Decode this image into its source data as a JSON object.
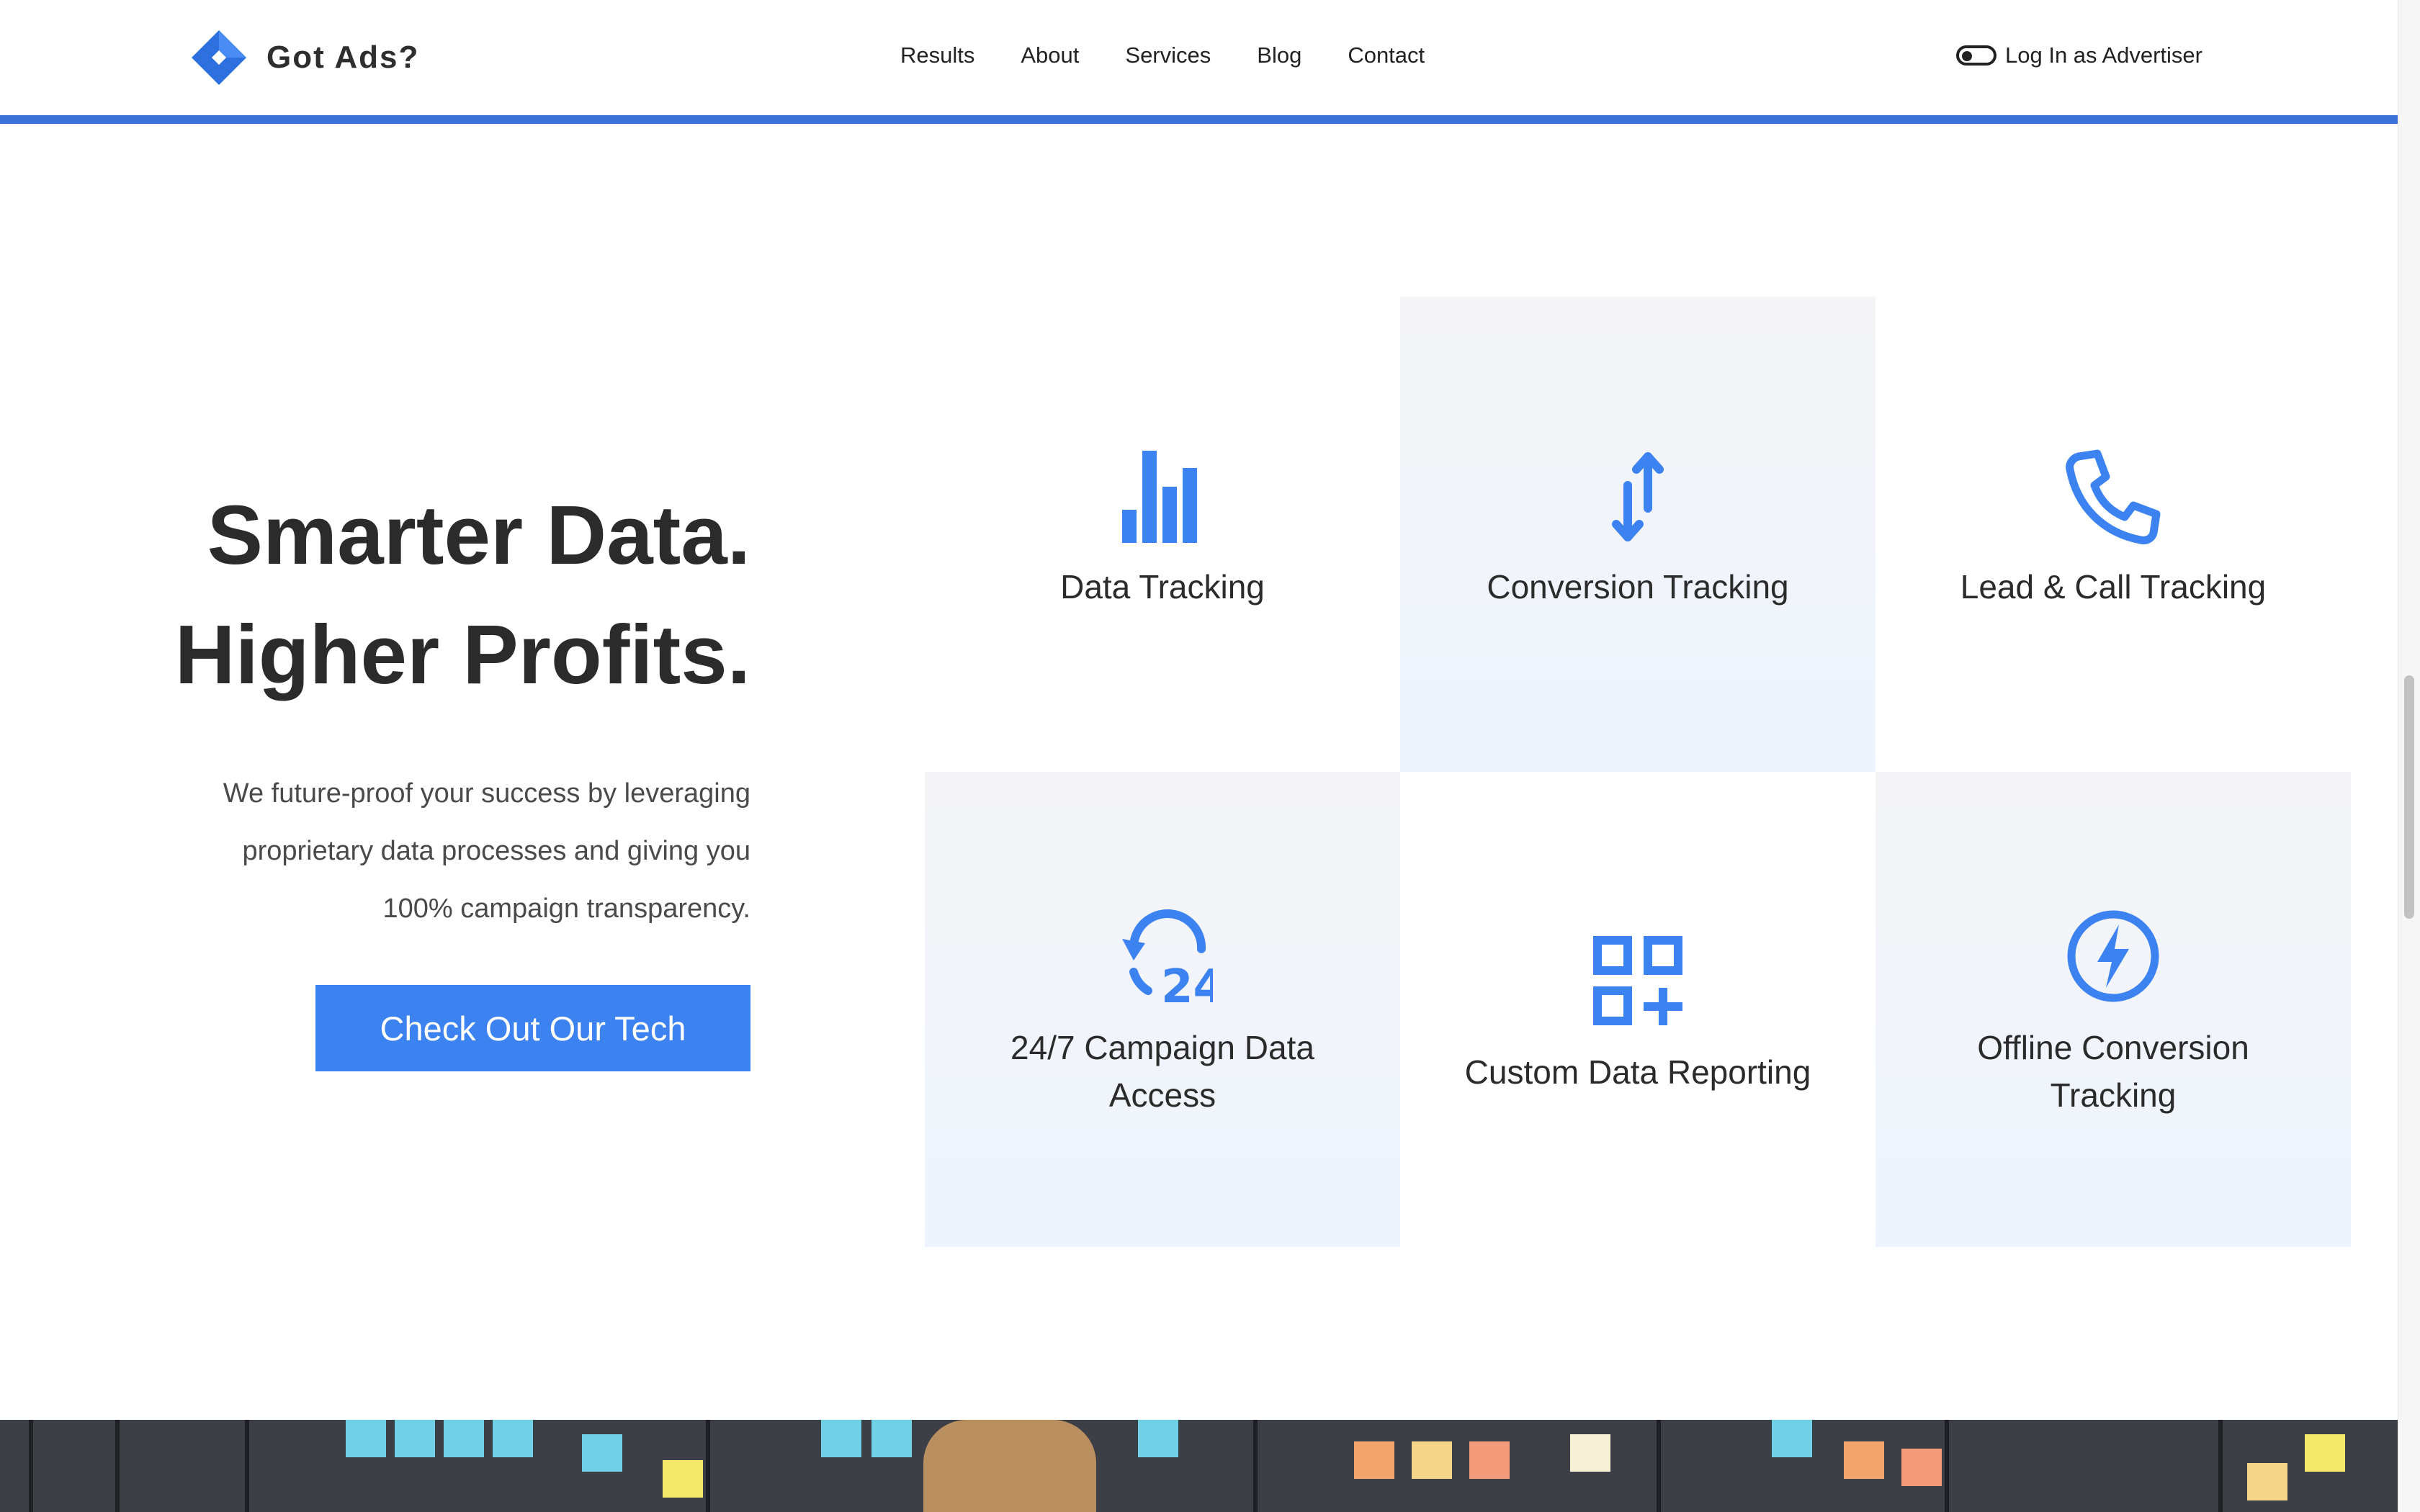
{
  "header": {
    "brand_name": "Got Ads?",
    "nav": [
      "Results",
      "About",
      "Services",
      "Blog",
      "Contact"
    ],
    "login_label": "Log In as Advertiser"
  },
  "hero": {
    "title_line1": "Smarter Data.",
    "title_line2": "Higher Profits.",
    "description_line1": "We future-proof your success by leveraging",
    "description_line2": "proprietary data processes and giving you",
    "description_line3": "100% campaign transparency.",
    "cta_label": "Check Out Our Tech"
  },
  "features": [
    {
      "label": "Data Tracking",
      "icon": "bar-chart-icon"
    },
    {
      "label": "Conversion Tracking",
      "icon": "swap-arrows-icon"
    },
    {
      "label": "Lead & Call Tracking",
      "icon": "phone-icon"
    },
    {
      "label": "24/7 Campaign Data Access",
      "icon": "clock-24-icon"
    },
    {
      "label": "Custom Data Reporting",
      "icon": "grid-plus-icon"
    },
    {
      "label": "Offline Conversion Tracking",
      "icon": "lightning-icon"
    }
  ],
  "colors": {
    "accent": "#3d82f1",
    "nav_underline": "#3a72d8",
    "text": "#2b2b2b",
    "tile_shade": "#eef4fd"
  }
}
